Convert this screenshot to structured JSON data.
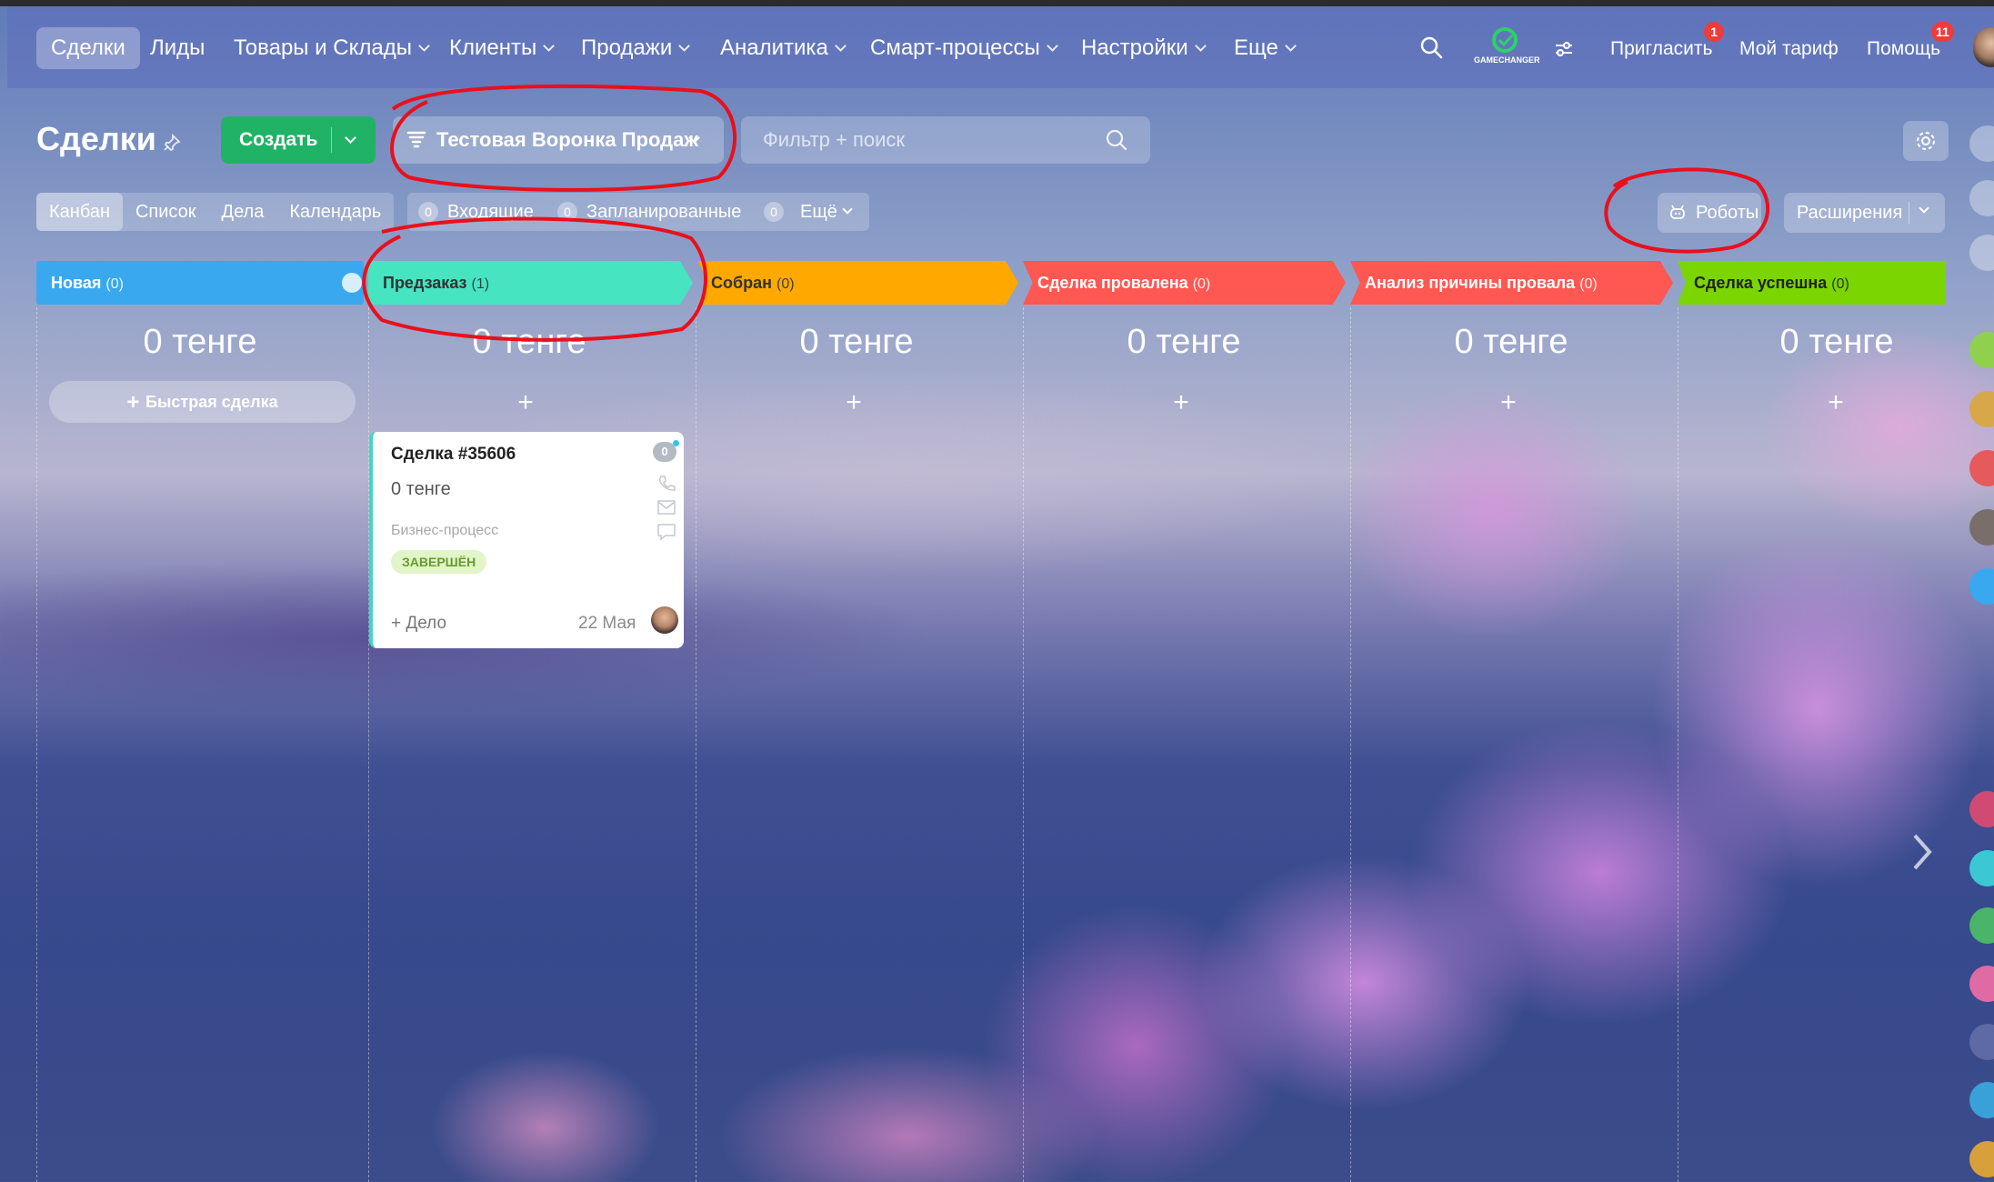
{
  "nav": {
    "items": [
      {
        "label": "Сделки",
        "active": true
      },
      {
        "label": "Лиды"
      },
      {
        "label": "Товары и Склады"
      },
      {
        "label": "Клиенты"
      },
      {
        "label": "Продажи"
      },
      {
        "label": "Аналитика"
      },
      {
        "label": "Смарт-процессы"
      },
      {
        "label": "Настройки"
      },
      {
        "label": "Еще"
      }
    ],
    "logo_text": "GAMECHANGER",
    "invite_label": "Пригласить",
    "invite_badge": "1",
    "tariff_label": "Мой тариф",
    "help_label": "Помощь",
    "help_badge": "11"
  },
  "toolbar": {
    "page_title": "Сделки",
    "create_label": "Создать",
    "funnel_label": "Тестовая Воронка Продаж",
    "filter_placeholder": "Фильтр + поиск"
  },
  "views": {
    "tabs": [
      "Канбан",
      "Список",
      "Дела",
      "Календарь"
    ],
    "active_tab": "Канбан",
    "counters": [
      {
        "count": "0",
        "label": "Входящие"
      },
      {
        "count": "0",
        "label": "Запланированные"
      },
      {
        "count": "0",
        "label": "Ещё"
      }
    ],
    "robots_label": "Роботы",
    "extensions_label": "Расширения"
  },
  "stages": [
    {
      "name": "Новая",
      "count": "(0)",
      "color": "#39a8ef",
      "sum": "0 тенге"
    },
    {
      "name": "Предзаказ",
      "count": "(1)",
      "color": "#47e4c2",
      "sum": "0 тенге"
    },
    {
      "name": "Собран",
      "count": "(0)",
      "color": "#ffa900",
      "sum": "0 тенге"
    },
    {
      "name": "Сделка провалена",
      "count": "(0)",
      "color": "#ff5752",
      "sum": "0 тенге"
    },
    {
      "name": "Анализ причины провала",
      "count": "(0)",
      "color": "#ff5752",
      "sum": "0 тенге"
    },
    {
      "name": "Сделка успешна",
      "count": "(0)",
      "color": "#7bd500",
      "sum": "0 тенге"
    }
  ],
  "quick_deal_label": "Быстрая сделка",
  "card": {
    "title": "Сделка #35606",
    "amount": "0 тенге",
    "process_label": "Бизнес-процесс",
    "status": "ЗАВЕРШЁН",
    "status_color": "#e1f5c9",
    "activity_count": "0",
    "add_task": "+ Дело",
    "date": "22 Мая"
  },
  "annotation_color": "#e8101c"
}
